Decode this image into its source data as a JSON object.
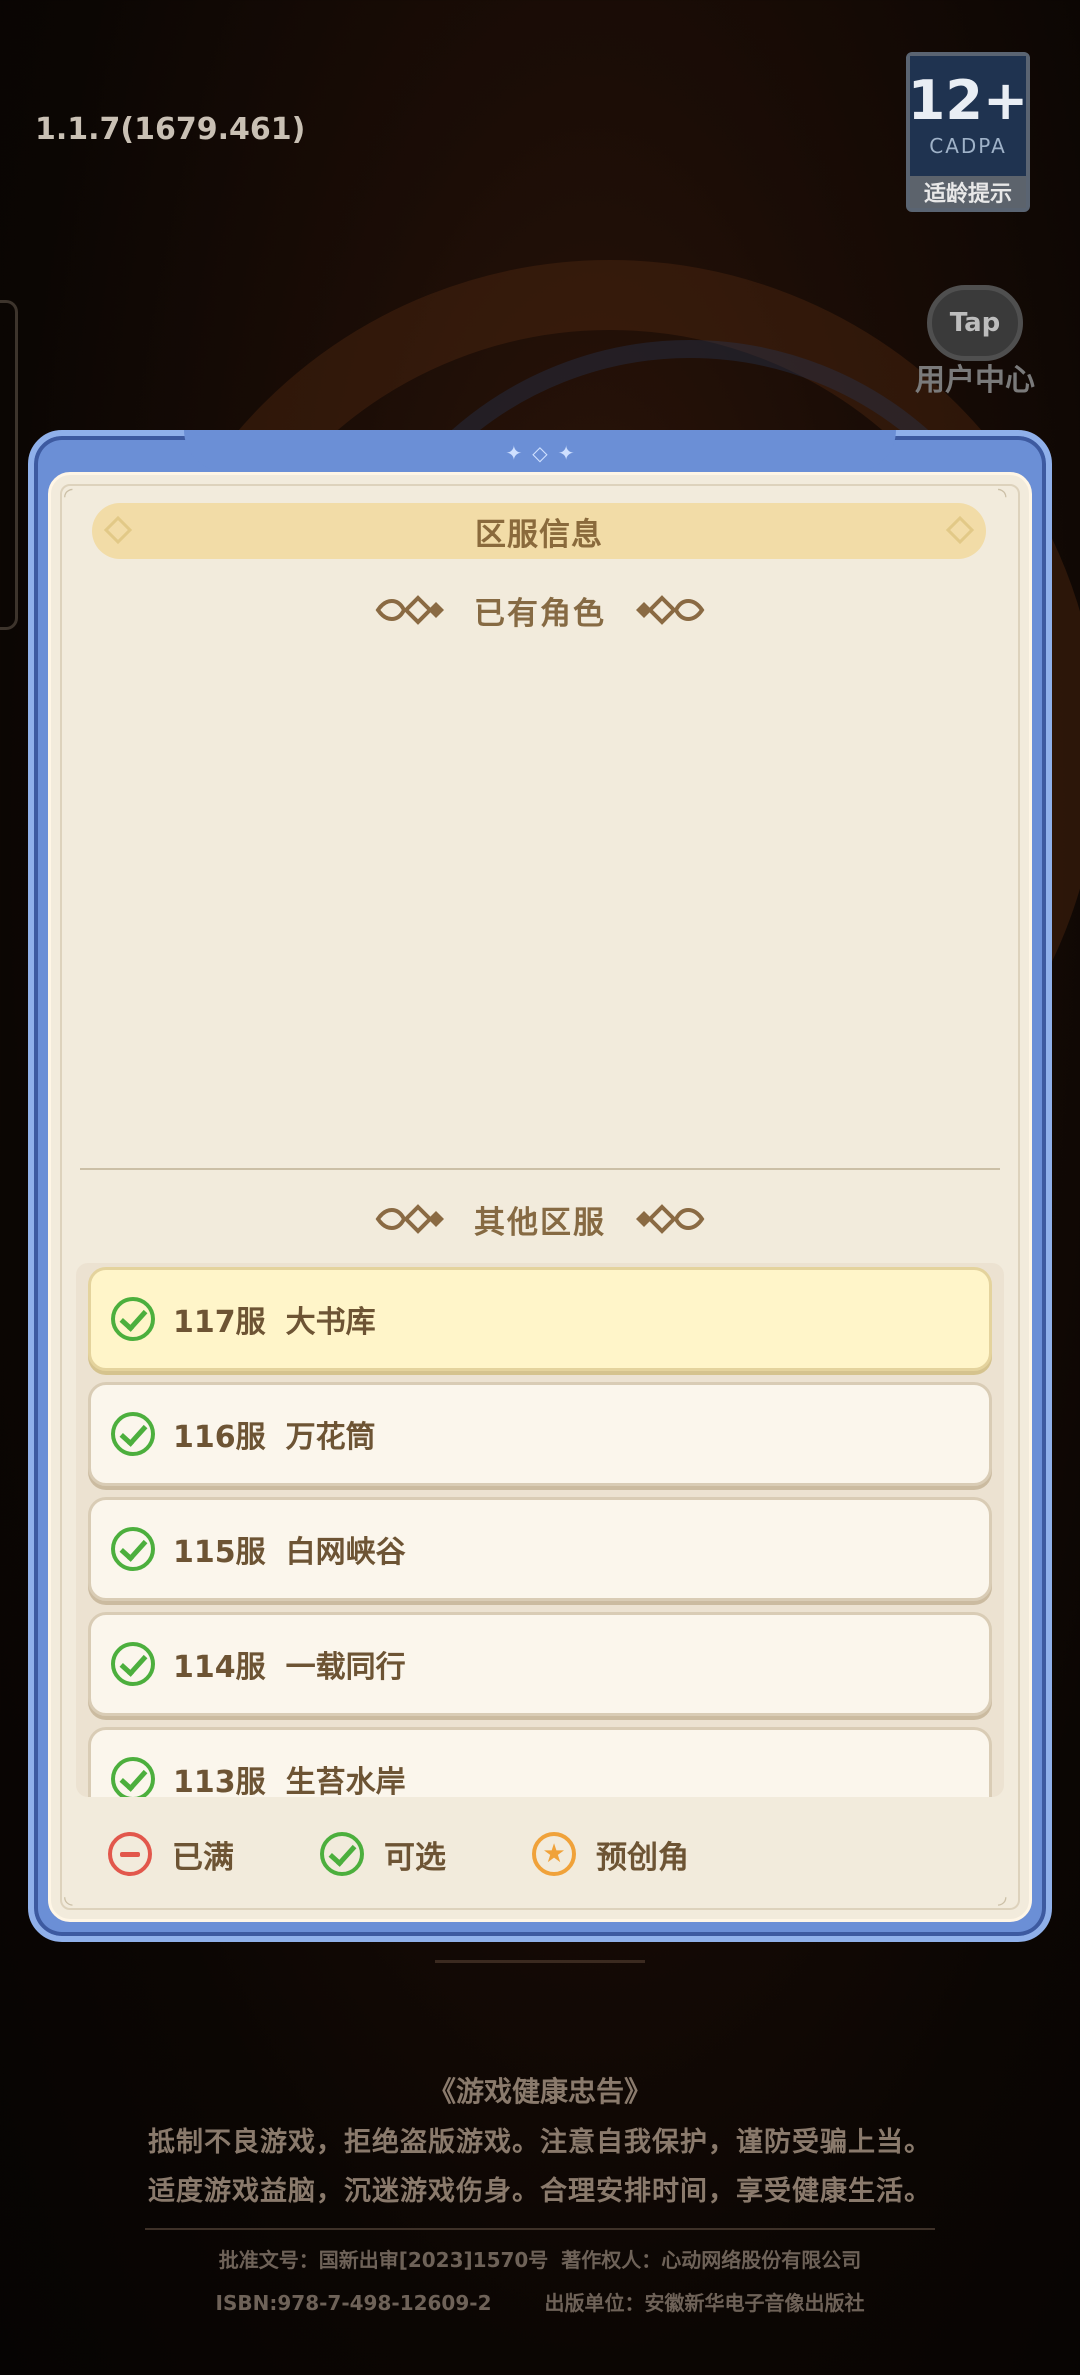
{
  "version": "1.1.7(1679.461)",
  "age_rating": {
    "number": "12+",
    "org": "CADPA",
    "label": "适龄提示"
  },
  "user_center": {
    "icon_text": "Tap",
    "label": "用户中心"
  },
  "dialog": {
    "title": "区服信息",
    "existing_section": "已有角色",
    "other_section": "其他区服",
    "servers": [
      {
        "num": "117服",
        "name": "大书库",
        "status": "available",
        "selected": true
      },
      {
        "num": "116服",
        "name": "万花筒",
        "status": "available",
        "selected": false
      },
      {
        "num": "115服",
        "name": "白网峡谷",
        "status": "available",
        "selected": false
      },
      {
        "num": "114服",
        "name": "一载同行",
        "status": "available",
        "selected": false
      },
      {
        "num": "113服",
        "name": "生苔水岸",
        "status": "available",
        "selected": false
      }
    ],
    "legend": {
      "full": "已满",
      "available": "可选",
      "precreate": "预创角"
    }
  },
  "footer": {
    "title": "《游戏健康忠告》",
    "line1": "抵制不良游戏，拒绝盗版游戏。注意自我保护，谨防受骗上当。",
    "line2": "适度游戏益脑，沉迷游戏伤身。合理安排时间，享受健康生活。",
    "approval": "批准文号：国新出审[2023]1570号",
    "copyright": "著作权人：心动网络股份有限公司",
    "isbn": "ISBN:978-7-498-12609-2",
    "publisher": "出版单位：安徽新华电子音像出版社"
  },
  "colors": {
    "accent_blue": "#6b8fd6",
    "available_green": "#4caf3d",
    "full_red": "#e2574c",
    "precreate_orange": "#f0a23a",
    "text_brown": "#6d5434"
  }
}
